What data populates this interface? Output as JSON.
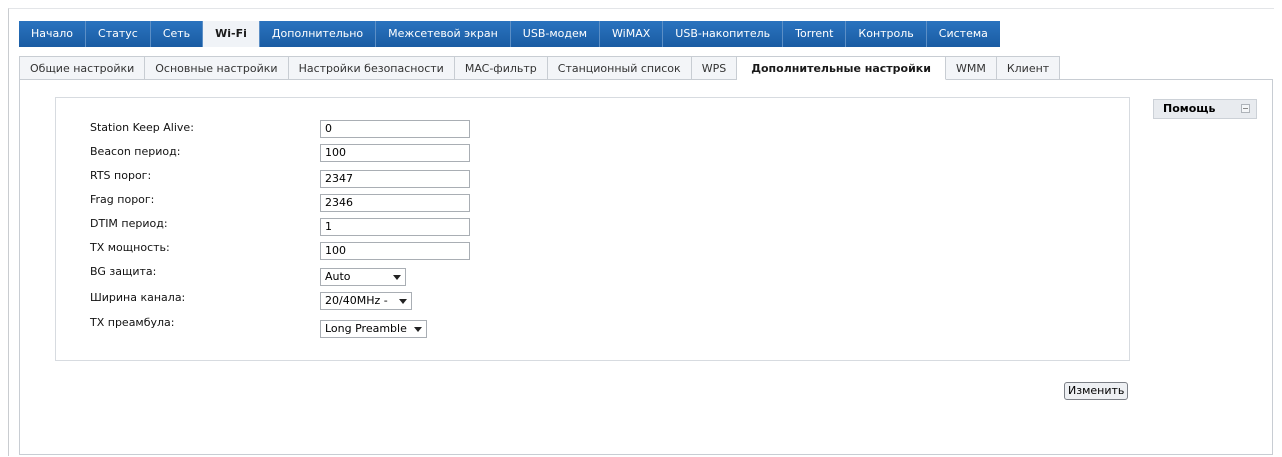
{
  "main_tabs": [
    {
      "label": "Начало"
    },
    {
      "label": "Статус"
    },
    {
      "label": "Сеть"
    },
    {
      "label": "Wi-Fi"
    },
    {
      "label": "Дополнительно"
    },
    {
      "label": "Межсетевой экран"
    },
    {
      "label": "USB-модем"
    },
    {
      "label": "WiMAX"
    },
    {
      "label": "USB-накопитель"
    },
    {
      "label": "Torrent"
    },
    {
      "label": "Контроль"
    },
    {
      "label": "Система"
    }
  ],
  "sub_tabs": [
    {
      "label": "Общие настройки"
    },
    {
      "label": "Основные настройки"
    },
    {
      "label": "Настройки безопасности"
    },
    {
      "label": "MAC-фильтр"
    },
    {
      "label": "Станционный список"
    },
    {
      "label": "WPS"
    },
    {
      "label": "Дополнительные настройки"
    },
    {
      "label": "WMM"
    },
    {
      "label": "Клиент"
    }
  ],
  "form": {
    "station_keep_alive": {
      "label": "Station Keep Alive:",
      "value": "0"
    },
    "beacon_period": {
      "label": "Beacon период:",
      "value": "100"
    },
    "rts_threshold": {
      "label": "RTS порог:",
      "value": "2347"
    },
    "frag_threshold": {
      "label": "Frag порог:",
      "value": "2346"
    },
    "dtim_period": {
      "label": "DTIM период:",
      "value": "1"
    },
    "tx_power": {
      "label": "TX мощность:",
      "value": "100"
    },
    "bg_protection": {
      "label": "BG защита:",
      "value": "Auto"
    },
    "channel_width": {
      "label": "Ширина канала:",
      "value": "20/40MHz -"
    },
    "tx_preamble": {
      "label": "TX преамбула:",
      "value": "Long Preamble"
    }
  },
  "help": {
    "label": "Помощь"
  },
  "actions": {
    "change_label": "Изменить"
  }
}
